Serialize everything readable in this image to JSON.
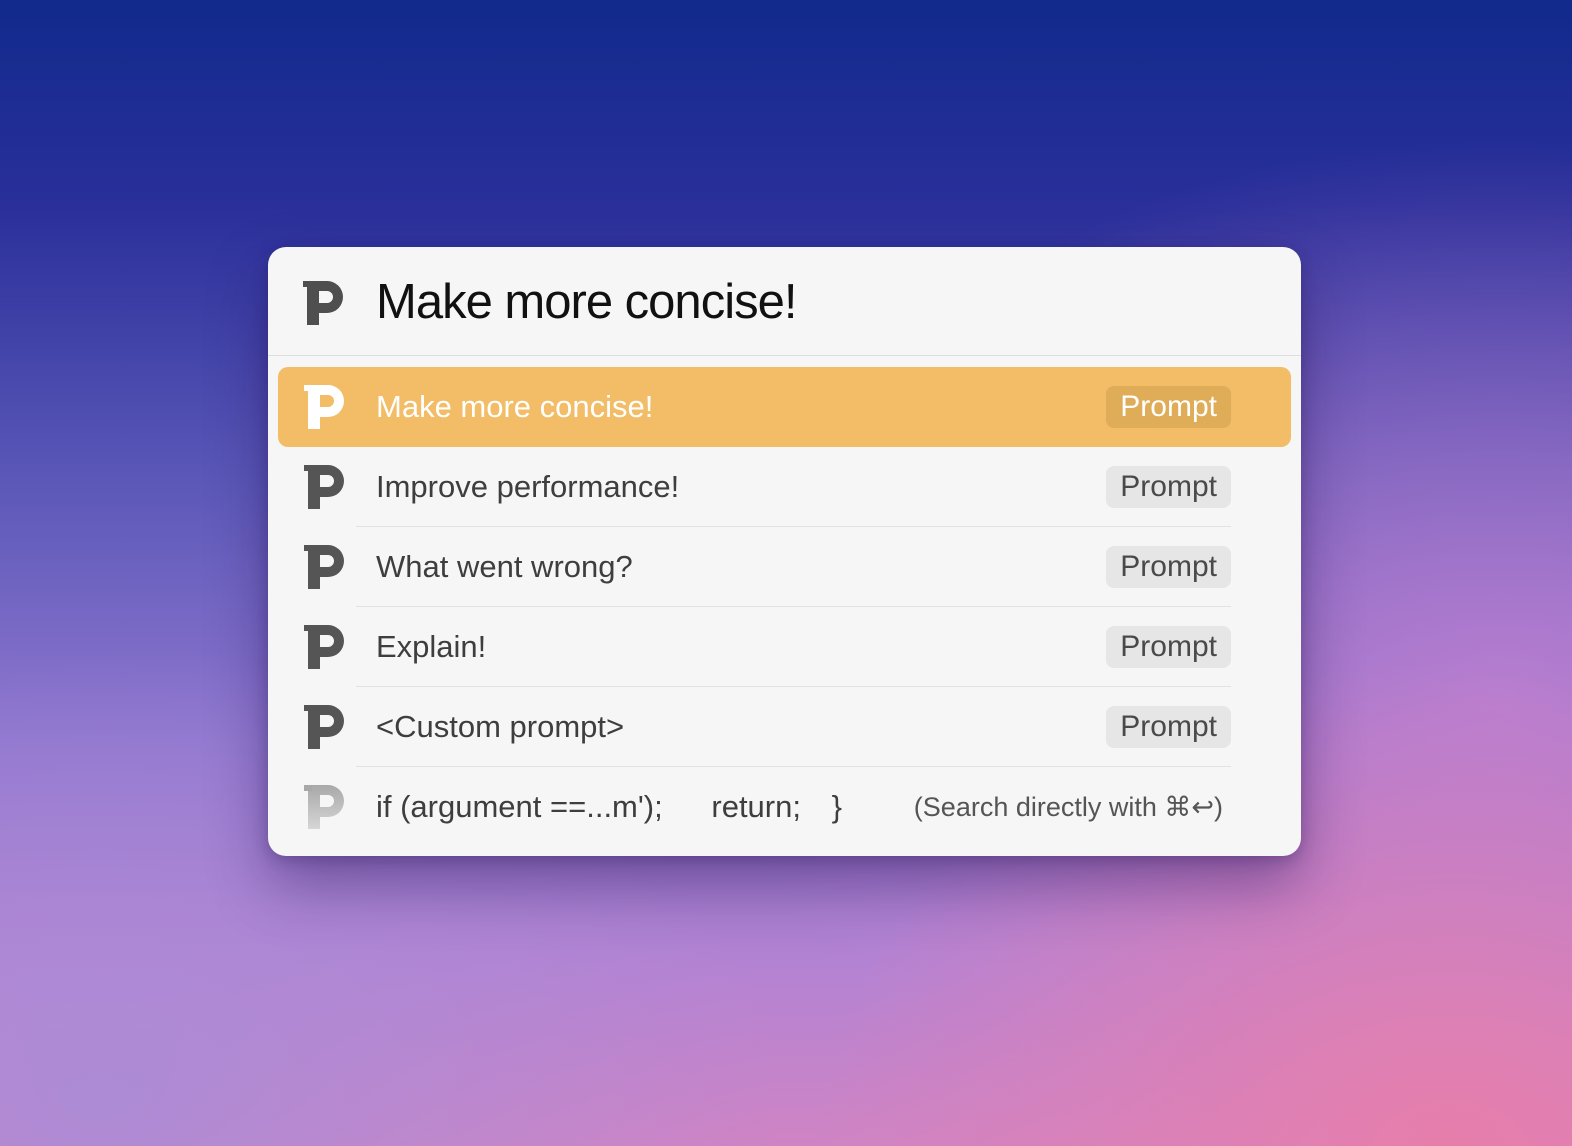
{
  "search": {
    "query": "Make more concise!",
    "icon": "p-logo-icon"
  },
  "results": [
    {
      "label": "Make more concise!",
      "badge": "Prompt",
      "selected": true
    },
    {
      "label": "Improve performance!",
      "badge": "Prompt",
      "selected": false
    },
    {
      "label": "What went wrong?",
      "badge": "Prompt",
      "selected": false
    },
    {
      "label": "Explain!",
      "badge": "Prompt",
      "selected": false
    },
    {
      "label": "<Custom prompt>",
      "badge": "Prompt",
      "selected": false
    }
  ],
  "direct_search": {
    "code_a": "if (argument ==...m');",
    "code_b": "return;",
    "code_c": "}",
    "hint": "(Search directly with ⌘↩)"
  },
  "colors": {
    "selected_row": "#f2bd66",
    "selected_badge": "#dfac58",
    "panel": "#f6f6f6",
    "icon": "#555555"
  }
}
